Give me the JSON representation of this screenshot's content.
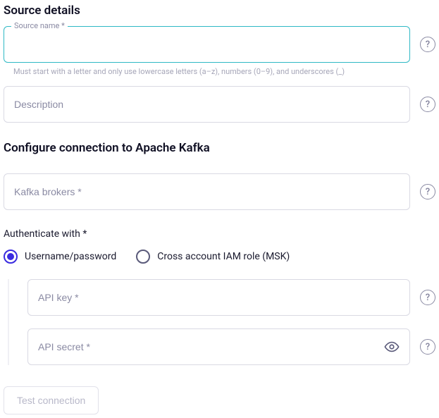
{
  "sections": {
    "source_details_title": "Source details",
    "configure_title": "Configure connection to Apache Kafka"
  },
  "fields": {
    "source_name": {
      "label": "Source name *",
      "value": "",
      "hint": "Must start with a letter and only use lowercase letters (a–z), numbers (0–9), and underscores (_)"
    },
    "description": {
      "placeholder": "Description",
      "value": ""
    },
    "kafka_brokers": {
      "placeholder": "Kafka brokers *",
      "value": ""
    },
    "api_key": {
      "placeholder": "API key *",
      "value": ""
    },
    "api_secret": {
      "placeholder": "API secret *",
      "value": ""
    }
  },
  "auth": {
    "label": "Authenticate with *",
    "options": {
      "userpass": "Username/password",
      "iam": "Cross account IAM role (MSK)"
    },
    "selected": "userpass"
  },
  "buttons": {
    "test_connection": "Test connection"
  },
  "glyphs": {
    "help": "?"
  }
}
